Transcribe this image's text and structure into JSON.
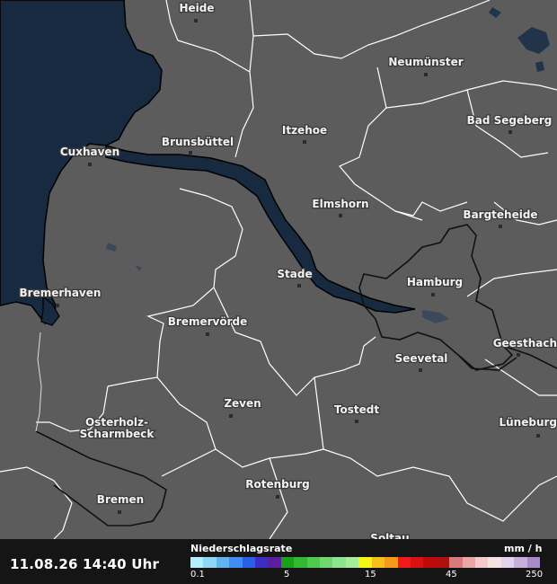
{
  "colors": {
    "land": "#5c5c5c",
    "water": "#172a40",
    "border": "#ffffff",
    "state_border": "#111111",
    "bar_background": "#151515"
  },
  "cities": [
    {
      "name": "Heide"
    },
    {
      "name": "Neumünster"
    },
    {
      "name": "Bad Segeberg"
    },
    {
      "name": "Itzehoe"
    },
    {
      "name": "Brunsbüttel"
    },
    {
      "name": "Cuxhaven"
    },
    {
      "name": "Elmshorn"
    },
    {
      "name": "Bargteheide"
    },
    {
      "name": "Hamburg"
    },
    {
      "name": "Stade"
    },
    {
      "name": "Bremerhaven"
    },
    {
      "name": "Bremervörde"
    },
    {
      "name": "Geesthach"
    },
    {
      "name": "Seevetal"
    },
    {
      "name": "Zeven"
    },
    {
      "name": "Tostedt"
    },
    {
      "name": "Osterholz-"
    },
    {
      "name": "Scharmbeck"
    },
    {
      "name": "Lüneburg"
    },
    {
      "name": "Rotenburg"
    },
    {
      "name": "Bremen"
    },
    {
      "name": "Soltau"
    }
  ],
  "footer": {
    "timestamp": "11.08.26 14:40 Uhr",
    "legend_title": "Niederschlagsrate",
    "legend_unit": "mm / h",
    "ticks": [
      "0.1",
      "5",
      "15",
      "45",
      "250"
    ],
    "scale_colors": [
      "#b4eefc",
      "#8fd6f7",
      "#62b4f0",
      "#3f8ef0",
      "#2a60e8",
      "#3a2fc2",
      "#5a1ea0",
      "#1aa11a",
      "#33b833",
      "#4ec94e",
      "#6fd86f",
      "#8fe48f",
      "#a8ee9a",
      "#f5f51a",
      "#f5c01a",
      "#f59a1a",
      "#f01a1a",
      "#d81212",
      "#c00a0a",
      "#b01010",
      "#d87a7a",
      "#eaa6a6",
      "#f5caca",
      "#f7e2e2",
      "#e2d4ec",
      "#c7b1dc",
      "#a88cc8"
    ]
  }
}
